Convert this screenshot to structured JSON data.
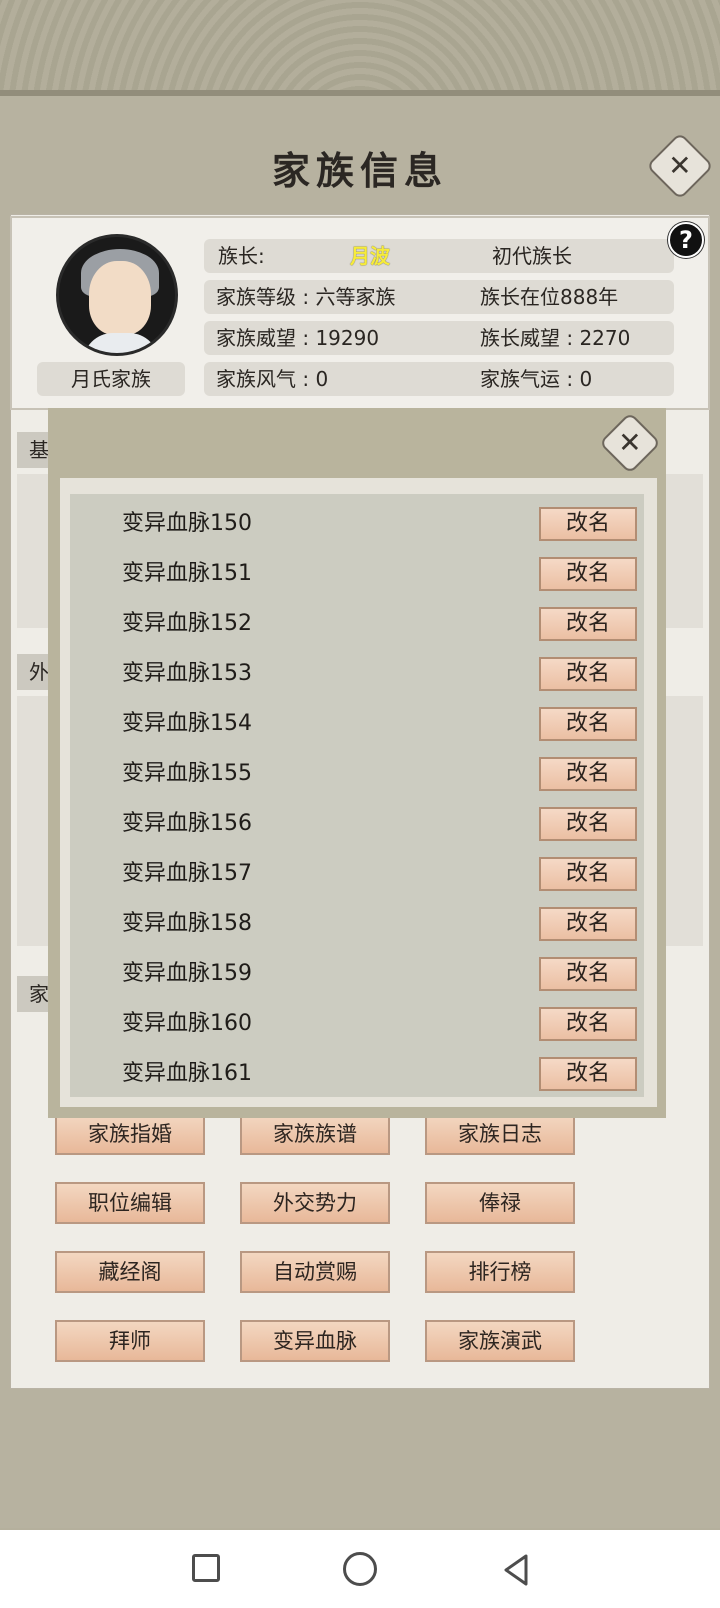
{
  "title": "家族信息",
  "help_glyph": "?",
  "close_glyph": "✕",
  "clan": {
    "name": "月氏家族",
    "leader_label": "族长:",
    "leader_name": "月波",
    "leader_title": "初代族长",
    "level_text": "家族等级 : 六等家族",
    "tenure_text": "族长在位888年",
    "prestige_text": "家族威望 : 19290",
    "leader_prestige_text": "族长威望 : 2270",
    "fengqi_text": "家族风气 : 0",
    "fortune_text": "家族气运 : 0"
  },
  "sections": [
    "基",
    "外",
    "家"
  ],
  "popup": {
    "rename_label": "改名",
    "items": [
      "变异血脉150",
      "变异血脉151",
      "变异血脉152",
      "变异血脉153",
      "变异血脉154",
      "变异血脉155",
      "变异血脉156",
      "变异血脉157",
      "变异血脉158",
      "变异血脉159",
      "变异血脉160",
      "变异血脉161"
    ]
  },
  "buttons": [
    [
      "家族指婚",
      "家族族谱",
      "家族日志"
    ],
    [
      "职位编辑",
      "外交势力",
      "俸禄"
    ],
    [
      "藏经阁",
      "自动赏赐",
      "排行榜"
    ],
    [
      "拜师",
      "变异血脉",
      "家族演武"
    ]
  ],
  "colors": {
    "leader_name": "#f7ec3a",
    "button_top": "#f3d7c1",
    "button_bottom": "#e8b899"
  }
}
